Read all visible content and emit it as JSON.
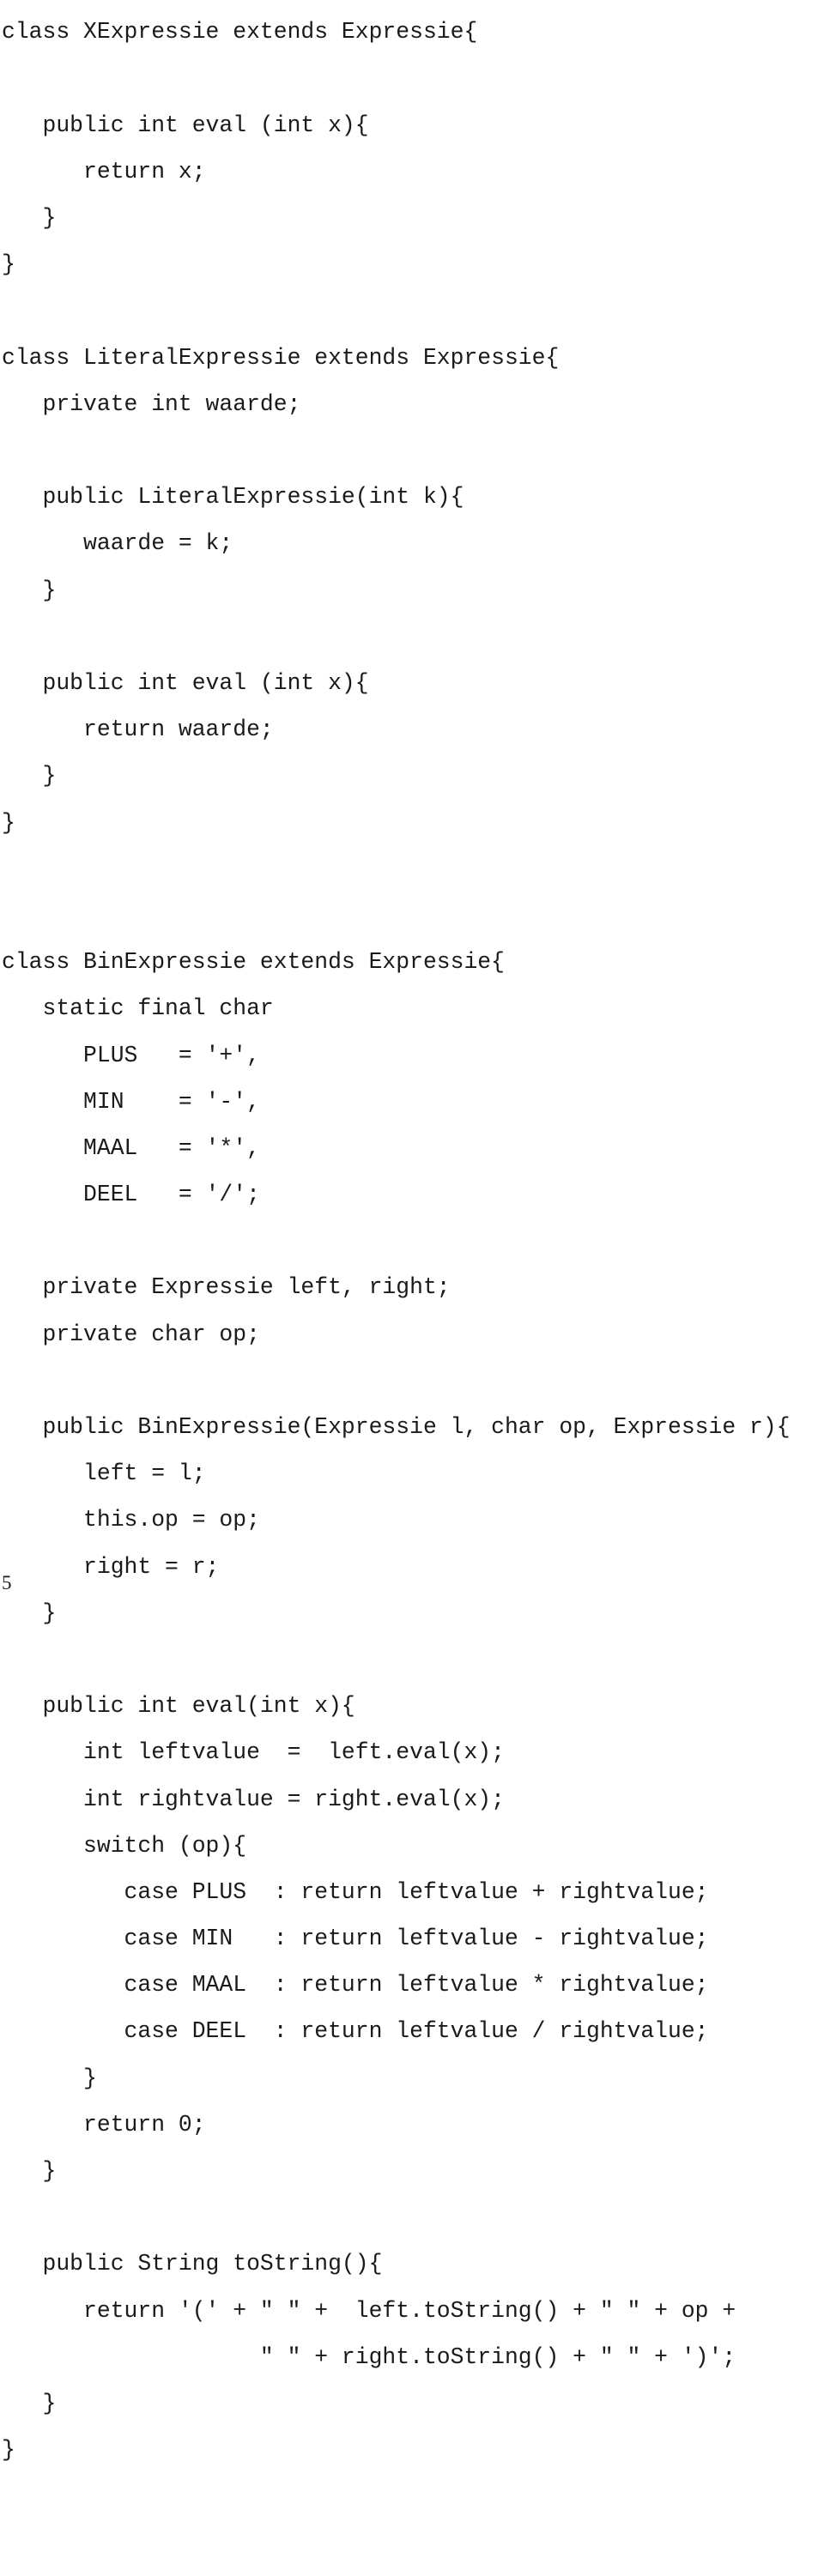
{
  "document": {
    "page_number": "5",
    "language": "java",
    "code_lines": [
      "class XExpressie extends Expressie{",
      "",
      "   public int eval (int x){",
      "      return x;",
      "   }",
      "}",
      "",
      "class LiteralExpressie extends Expressie{",
      "   private int waarde;",
      "",
      "   public LiteralExpressie(int k){",
      "      waarde = k;",
      "   }",
      "",
      "   public int eval (int x){",
      "      return waarde;",
      "   }",
      "}",
      "",
      "",
      "class BinExpressie extends Expressie{",
      "   static final char",
      "      PLUS   = '+',",
      "      MIN    = '-',",
      "      MAAL   = '*',",
      "      DEEL   = '/';",
      "",
      "   private Expressie left, right;",
      "   private char op;",
      "",
      "   public BinExpressie(Expressie l, char op, Expressie r){",
      "      left = l;",
      "      this.op = op;",
      "      right = r;",
      "   }",
      "",
      "   public int eval(int x){",
      "      int leftvalue  =  left.eval(x);",
      "      int rightvalue = right.eval(x);",
      "      switch (op){",
      "         case PLUS  : return leftvalue + rightvalue;",
      "         case MIN   : return leftvalue - rightvalue;",
      "         case MAAL  : return leftvalue * rightvalue;",
      "         case DEEL  : return leftvalue / rightvalue;",
      "      }",
      "      return 0;",
      "   }",
      "",
      "   public String toString(){",
      "      return '(' + \" \" +  left.toString() + \" \" + op +",
      "                   \" \" + right.toString() + \" \" + ')';",
      "   }",
      "}"
    ]
  }
}
